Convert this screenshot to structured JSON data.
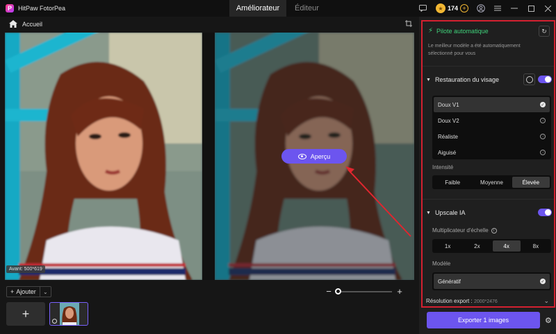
{
  "app": {
    "title": "HitPaw FotorPea",
    "logo_letter": "P"
  },
  "tabs": [
    {
      "label": "Améliorateur",
      "active": true
    },
    {
      "label": "Éditeur",
      "active": false
    }
  ],
  "titlebar": {
    "coins": "174"
  },
  "breadcrumb": {
    "home": "Accueil"
  },
  "canvas": {
    "original_badge": "Avant: 500*619",
    "preview_label": "Aperçu"
  },
  "bottom": {
    "add_label": "Ajouter",
    "zoom_level": 0
  },
  "panel": {
    "autopilot_label": "Pilote automatique",
    "autopilot_desc": "Le meilleur modèle a été automatiquement sélectionné pour vous",
    "face_restore": {
      "title": "Restauration du visage",
      "enabled": true,
      "models": [
        {
          "label": "Doux V1",
          "selected": true
        },
        {
          "label": "Doux V2",
          "selected": false
        },
        {
          "label": "Réaliste",
          "selected": false
        },
        {
          "label": "Aiguisé",
          "selected": false
        }
      ],
      "intensity_label": "Intensité",
      "intensity_options": [
        "Faible",
        "Moyenne",
        "Élevée"
      ],
      "intensity_selected": "Élevée"
    },
    "upscale": {
      "title": "Upscale IA",
      "enabled": true,
      "scale_label": "Multiplicateur d'échelle",
      "scale_options": [
        "1x",
        "2x",
        "4x",
        "8x"
      ],
      "scale_selected": "4x",
      "model_label": "Modèle",
      "model_selected": "Génératif"
    },
    "export_res_label": "Résolution export :",
    "export_res_value": "2000*2476",
    "export_button": "Exporter 1 images"
  },
  "colors": {
    "accent": "#6c55ef",
    "autopilot_green": "#3fd27a",
    "highlight_red": "#d42030"
  }
}
